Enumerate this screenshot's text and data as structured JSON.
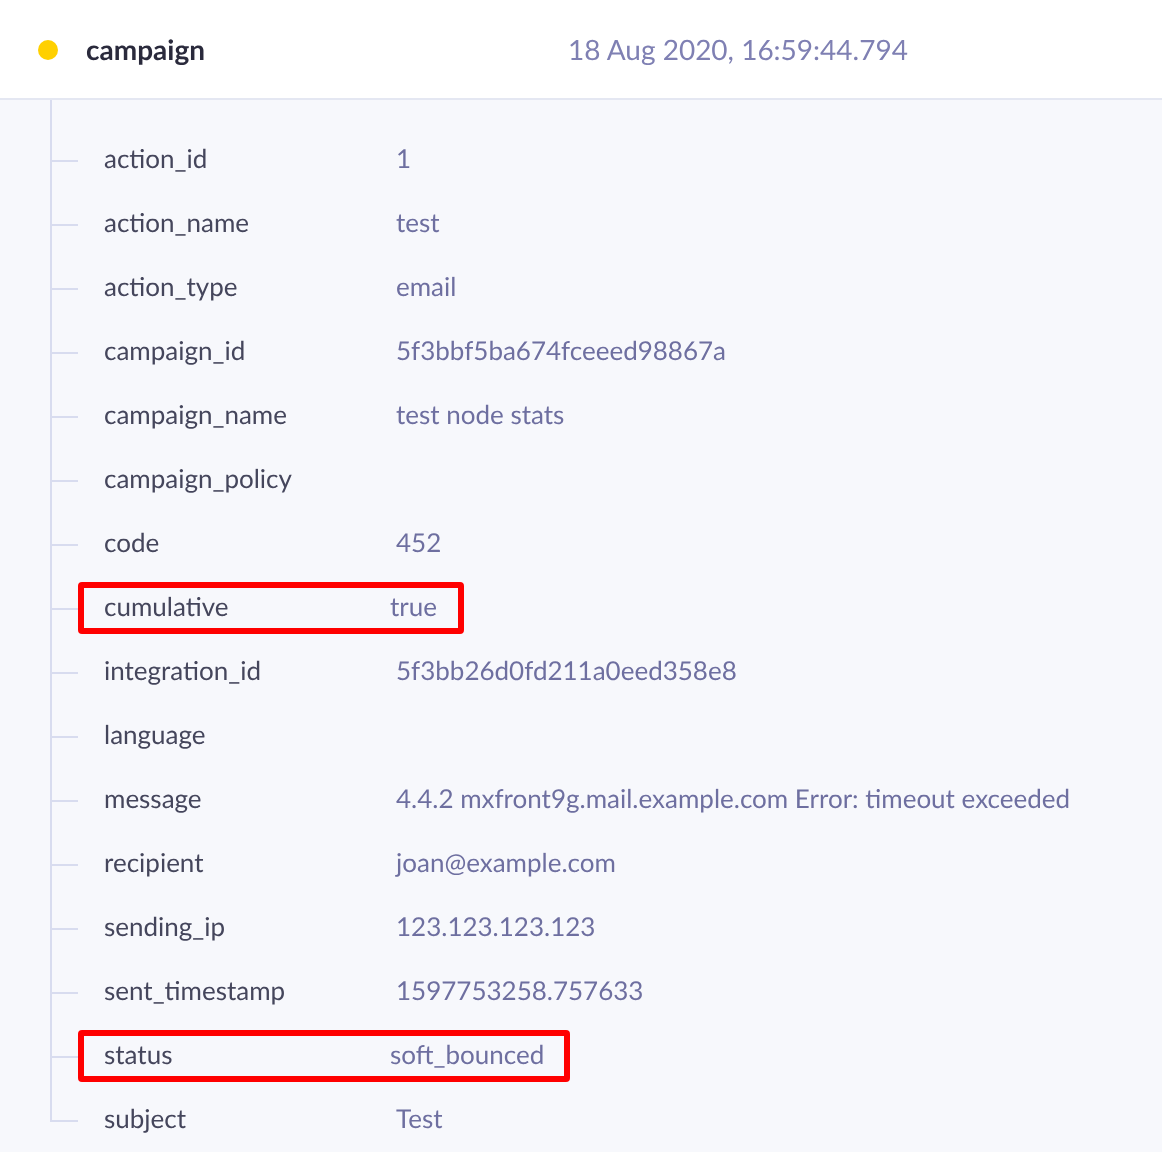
{
  "event": {
    "name": "campaign",
    "timestamp": "18 Aug 2020, 16:59:44.794"
  },
  "fields": [
    {
      "key": "action_id",
      "value": "1",
      "highlighted": false
    },
    {
      "key": "action_name",
      "value": "test",
      "highlighted": false
    },
    {
      "key": "action_type",
      "value": "email",
      "highlighted": false
    },
    {
      "key": "campaign_id",
      "value": "5f3bbf5ba674fceeed98867a",
      "highlighted": false
    },
    {
      "key": "campaign_name",
      "value": "test node stats",
      "highlighted": false
    },
    {
      "key": "campaign_policy",
      "highlighted": false
    },
    {
      "key": "code",
      "value": "452",
      "highlighted": false
    },
    {
      "key": "cumulative",
      "value": "true",
      "highlighted": true
    },
    {
      "key": "integration_id",
      "value": "5f3bb26d0fd211a0eed358e8",
      "highlighted": false
    },
    {
      "key": "language",
      "highlighted": false
    },
    {
      "key": "message",
      "value": "4.4.2 mxfront9g.mail.example.com Error: timeout exceeded",
      "highlighted": false
    },
    {
      "key": "recipient",
      "value": "joan@example.com",
      "highlighted": false
    },
    {
      "key": "sending_ip",
      "value": "123.123.123.123",
      "highlighted": false
    },
    {
      "key": "sent_timestamp",
      "value": "1597753258.757633",
      "highlighted": false
    },
    {
      "key": "status",
      "value": "soft_bounced",
      "highlighted": true
    },
    {
      "key": "subject",
      "value": "Test",
      "highlighted": false
    }
  ]
}
